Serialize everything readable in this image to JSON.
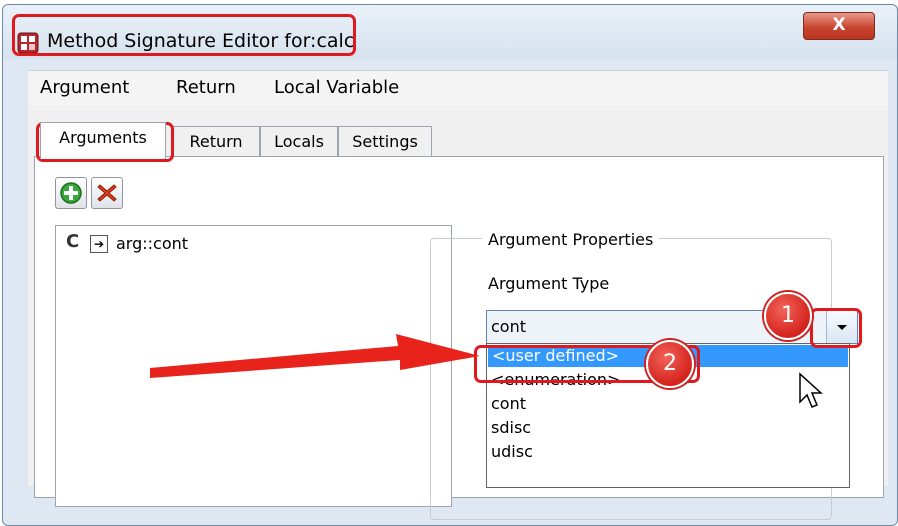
{
  "window": {
    "title_prefix": "Method Signature Editor for:",
    "title_suffix": "calc",
    "close_glyph": "X"
  },
  "menubar": {
    "items": [
      "Argument",
      "Return",
      "Local Variable"
    ]
  },
  "tabs": [
    "Arguments",
    "Return",
    "Locals",
    "Settings"
  ],
  "toolbar": {
    "add_icon": "add-icon",
    "delete_icon": "delete-icon"
  },
  "arguments_list": {
    "items": [
      {
        "label": "arg::cont",
        "type_glyph": "C"
      }
    ]
  },
  "properties": {
    "group_title": "Argument Properties",
    "type_label": "Argument Type",
    "type_value": "cont",
    "options": [
      "<user defined>",
      "<enumeration>",
      "cont",
      "sdisc",
      "udisc"
    ]
  },
  "annotations": {
    "badge1": "1",
    "badge2": "2"
  },
  "colors": {
    "annotation_red": "#e0191e",
    "selection_blue": "#3399ff"
  }
}
